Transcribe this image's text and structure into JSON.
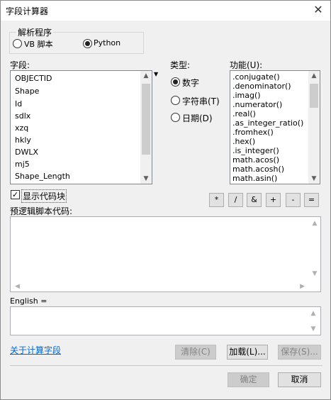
{
  "window": {
    "title": "字段计算器",
    "close_glyph": "✕"
  },
  "parser": {
    "label": "解析程序",
    "options": [
      {
        "label": "VB 脚本",
        "selected": false
      },
      {
        "label": "Python",
        "selected": true
      }
    ]
  },
  "fields": {
    "label": "字段:",
    "items": [
      "OBJECTID",
      "Shape",
      "Id",
      "sdlx",
      "xzq",
      "hkly",
      "DWLX",
      "mj5",
      "Shape_Length"
    ]
  },
  "type": {
    "label": "类型:",
    "options": [
      {
        "label": "数字",
        "selected": true
      },
      {
        "label": "字符串(T)",
        "selected": false
      },
      {
        "label": "日期(D)",
        "selected": false
      }
    ]
  },
  "functions": {
    "label": "功能(U):",
    "items": [
      ".conjugate()",
      ".denominator()",
      ".imag()",
      ".numerator()",
      ".real()",
      ".as_integer_ratio()",
      ".fromhex()",
      ".hex()",
      ".is_integer()",
      "math.acos()",
      "math.acosh()",
      "math.asin()"
    ]
  },
  "show_codeblock": {
    "label": "显示代码块",
    "checked": true,
    "check_glyph": "✓"
  },
  "operators": [
    "*",
    "/",
    "&",
    "+",
    "-",
    "="
  ],
  "pre_logic": {
    "label": "预逻辑脚本代码:"
  },
  "expression": {
    "label": "English ="
  },
  "about_link": "关于计算字段",
  "buttons": {
    "clear": "清除(C)",
    "load": "加载(L)...",
    "save": "保存(S)...",
    "ok": "确定",
    "cancel": "取消"
  }
}
